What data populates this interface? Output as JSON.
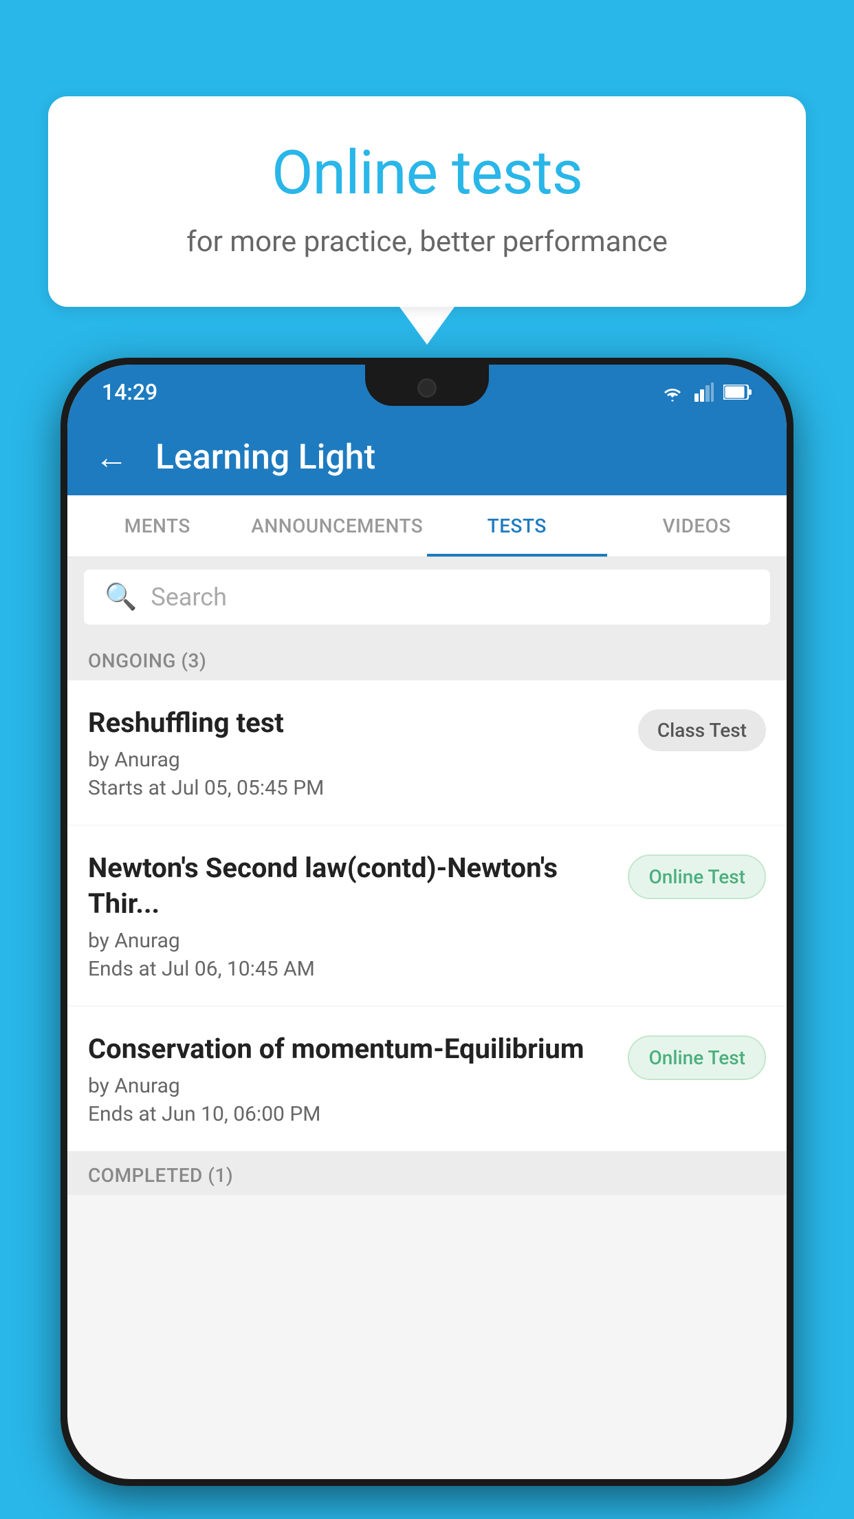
{
  "background": {
    "color": "#29b6e8"
  },
  "speech_bubble": {
    "title": "Online tests",
    "subtitle": "for more practice, better performance"
  },
  "status_bar": {
    "time": "14:29",
    "wifi": "▼",
    "signal": "▲",
    "battery": "▮"
  },
  "app_header": {
    "back_label": "←",
    "title": "Learning Light"
  },
  "tabs": [
    {
      "label": "MENTS",
      "active": false
    },
    {
      "label": "ANNOUNCEMENTS",
      "active": false
    },
    {
      "label": "TESTS",
      "active": true
    },
    {
      "label": "VIDEOS",
      "active": false
    }
  ],
  "search": {
    "placeholder": "Search"
  },
  "ongoing_section": {
    "label": "ONGOING (3)"
  },
  "tests": [
    {
      "title": "Reshuffling test",
      "author": "by Anurag",
      "date": "Starts at  Jul 05, 05:45 PM",
      "badge": "Class Test",
      "badge_type": "class"
    },
    {
      "title": "Newton's Second law(contd)-Newton's Thir...",
      "author": "by Anurag",
      "date": "Ends at  Jul 06, 10:45 AM",
      "badge": "Online Test",
      "badge_type": "online"
    },
    {
      "title": "Conservation of momentum-Equilibrium",
      "author": "by Anurag",
      "date": "Ends at  Jun 10, 06:00 PM",
      "badge": "Online Test",
      "badge_type": "online"
    }
  ],
  "completed_section": {
    "label": "COMPLETED (1)"
  }
}
